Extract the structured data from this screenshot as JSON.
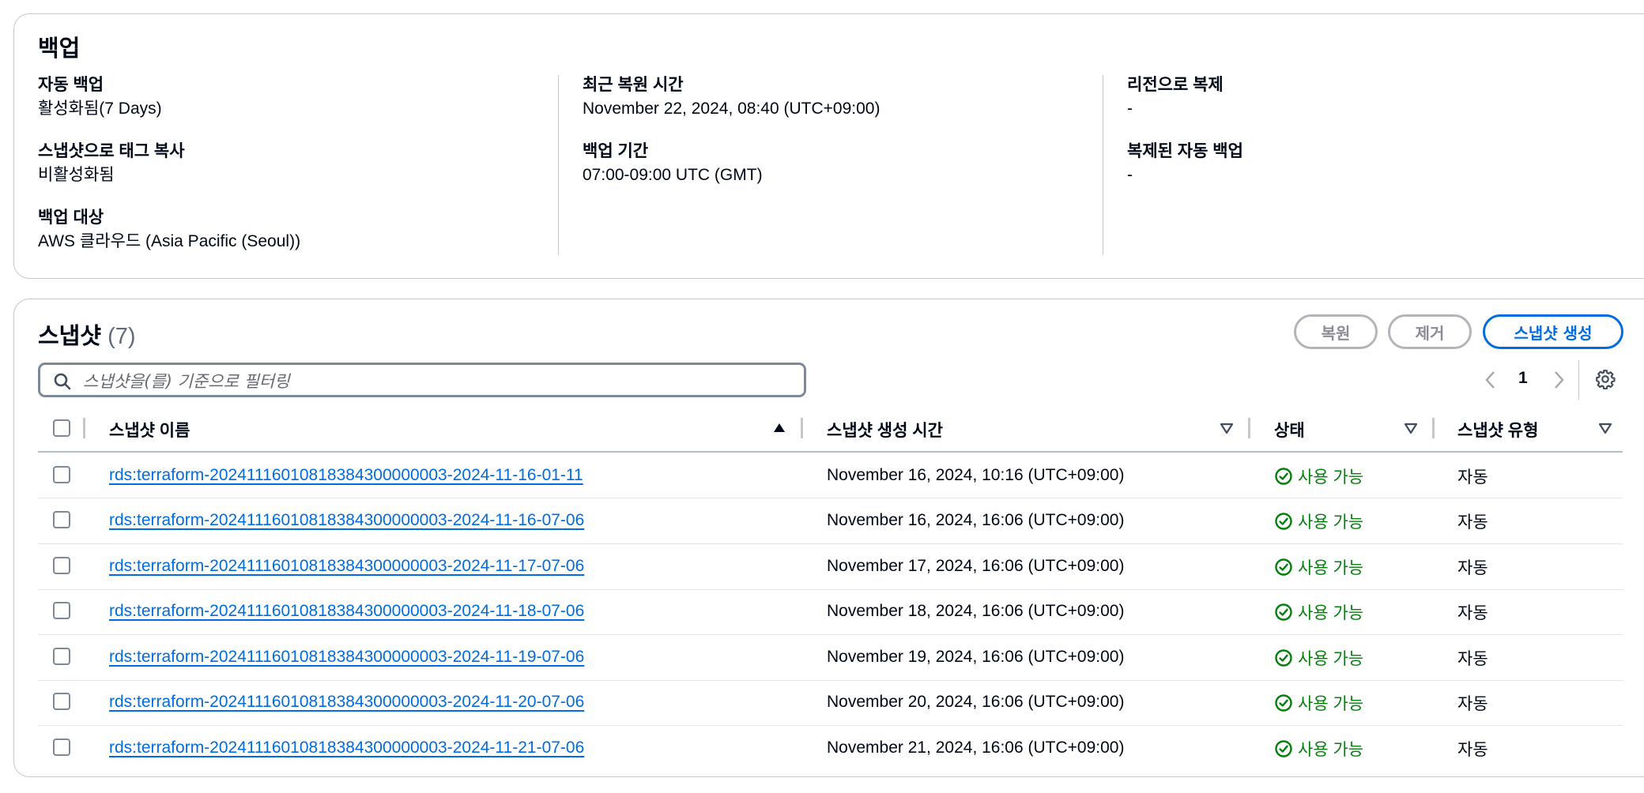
{
  "backup": {
    "title": "백업",
    "auto_backup": {
      "label": "자동 백업",
      "value": "활성화됨(7 Days)"
    },
    "copy_tags": {
      "label": "스냅샷으로 태그 복사",
      "value": "비활성화됨"
    },
    "backup_target": {
      "label": "백업 대상",
      "value": "AWS 클라우드 (Asia Pacific (Seoul))"
    },
    "latest_restore": {
      "label": "최근 복원 시간",
      "value": "November 22, 2024, 08:40 (UTC+09:00)"
    },
    "backup_window": {
      "label": "백업 기간",
      "value": "07:00-09:00 UTC (GMT)"
    },
    "region_copy": {
      "label": "리전으로 복제",
      "value": "-"
    },
    "replicated_backup": {
      "label": "복제된 자동 백업",
      "value": "-"
    }
  },
  "snapshots": {
    "title": "스냅샷",
    "count": "(7)",
    "buttons": {
      "restore": "복원",
      "delete": "제거",
      "create": "스냅샷 생성"
    },
    "search_placeholder": "스냅샷을(를) 기준으로 필터링",
    "page": "1",
    "columns": {
      "name": "스냅샷 이름",
      "created": "스냅샷 생성 시간",
      "status": "상태",
      "type": "스냅샷 유형"
    },
    "rows": [
      {
        "name": "rds:terraform-20241116010818384300000003-2024-11-16-01-11",
        "created": "November 16, 2024, 10:16 (UTC+09:00)",
        "status": "사용 가능",
        "type": "자동"
      },
      {
        "name": "rds:terraform-20241116010818384300000003-2024-11-16-07-06",
        "created": "November 16, 2024, 16:06 (UTC+09:00)",
        "status": "사용 가능",
        "type": "자동"
      },
      {
        "name": "rds:terraform-20241116010818384300000003-2024-11-17-07-06",
        "created": "November 17, 2024, 16:06 (UTC+09:00)",
        "status": "사용 가능",
        "type": "자동"
      },
      {
        "name": "rds:terraform-20241116010818384300000003-2024-11-18-07-06",
        "created": "November 18, 2024, 16:06 (UTC+09:00)",
        "status": "사용 가능",
        "type": "자동"
      },
      {
        "name": "rds:terraform-20241116010818384300000003-2024-11-19-07-06",
        "created": "November 19, 2024, 16:06 (UTC+09:00)",
        "status": "사용 가능",
        "type": "자동"
      },
      {
        "name": "rds:terraform-20241116010818384300000003-2024-11-20-07-06",
        "created": "November 20, 2024, 16:06 (UTC+09:00)",
        "status": "사용 가능",
        "type": "자동"
      },
      {
        "name": "rds:terraform-20241116010818384300000003-2024-11-21-07-06",
        "created": "November 21, 2024, 16:06 (UTC+09:00)",
        "status": "사용 가능",
        "type": "자동"
      }
    ]
  },
  "colors": {
    "link": "#006ce0",
    "success": "#037f0c",
    "border": "#c6c6cd"
  },
  "icons": {
    "search": "search-icon",
    "settings": "gear-icon",
    "status": "check-circle-icon",
    "sort_asc": "sort-ascending-icon",
    "sort": "sort-icon"
  }
}
